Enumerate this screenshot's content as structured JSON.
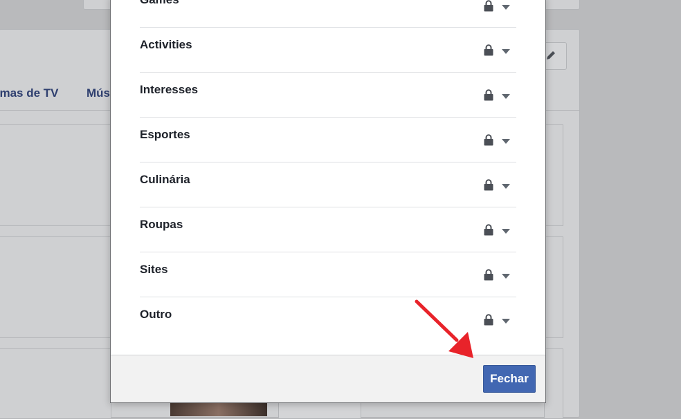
{
  "background": {
    "tabs": [
      "amas de TV",
      "Mús"
    ]
  },
  "dialog": {
    "categories": [
      {
        "label": "Games",
        "privacy_icon": "lock-icon"
      },
      {
        "label": "Activities",
        "privacy_icon": "lock-icon"
      },
      {
        "label": "Interesses",
        "privacy_icon": "lock-icon"
      },
      {
        "label": "Esportes",
        "privacy_icon": "lock-icon"
      },
      {
        "label": "Culinária",
        "privacy_icon": "lock-icon"
      },
      {
        "label": "Roupas",
        "privacy_icon": "lock-icon"
      },
      {
        "label": "Sites",
        "privacy_icon": "lock-icon"
      },
      {
        "label": "Outro",
        "privacy_icon": "lock-icon"
      }
    ],
    "close_label": "Fechar"
  },
  "colors": {
    "primary_button": "#4267b2",
    "annotation_arrow": "#e8232a",
    "overlay": "#b9babc"
  }
}
